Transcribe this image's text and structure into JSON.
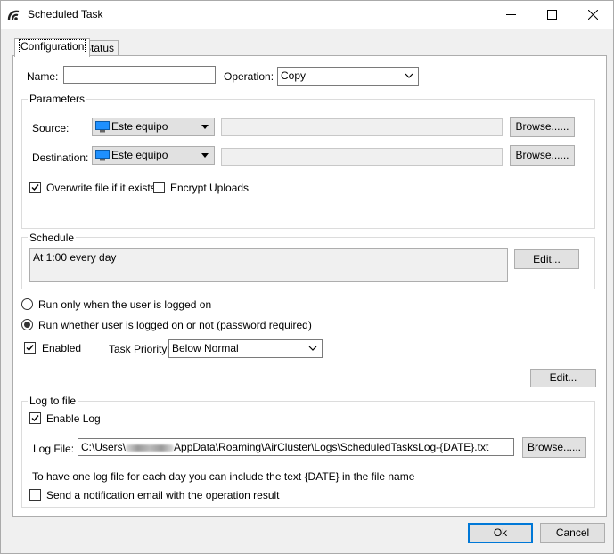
{
  "window": {
    "title": "Scheduled Task"
  },
  "tabs": [
    {
      "label": "Configuration"
    },
    {
      "label": "Status"
    }
  ],
  "form": {
    "name_label": "Name:",
    "name_value": "",
    "operation_label": "Operation:",
    "operation_value": "Copy"
  },
  "parameters": {
    "title": "Parameters",
    "source_label": "Source:",
    "source_location": "Este equipo",
    "source_path": "",
    "destination_label": "Destination:",
    "destination_location": "Este equipo",
    "destination_path": "",
    "browse_label": "Browse......",
    "overwrite_label": "Overwrite file if it exists",
    "overwrite_checked": true,
    "encrypt_label": "Encrypt Uploads",
    "encrypt_checked": false
  },
  "schedule": {
    "title": "Schedule",
    "text": "At 1:00 every day",
    "edit_label": "Edit..."
  },
  "run": {
    "logged_on_label": "Run only when the user is logged on",
    "whether_label": "Run whether user is logged on or not (password required)",
    "selected": "whether"
  },
  "enabled": {
    "label": "Enabled",
    "checked": true
  },
  "priority": {
    "label": "Task Priority",
    "value": "Below Normal"
  },
  "edit2_label": "Edit...",
  "log": {
    "title": "Log to file",
    "enable_label": "Enable Log",
    "enable_checked": true,
    "file_label": "Log File:",
    "file_prefix": "C:\\Users\\",
    "file_suffix": "AppData\\Roaming\\AirCluster\\Logs\\ScheduledTasksLog-{DATE}.txt",
    "browse_label": "Browse......",
    "hint": "To have one log file for each day you can include the text {DATE} in the file name",
    "notify_label": "Send a notification email with the operation result",
    "notify_checked": false
  },
  "footer": {
    "ok_label": "Ok",
    "cancel_label": "Cancel"
  },
  "colors": {
    "accent": "#0078d7",
    "monitor": "#1e90ff"
  }
}
